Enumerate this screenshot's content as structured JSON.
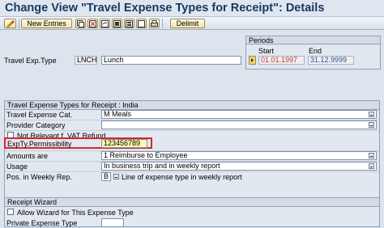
{
  "title": "Change View \"Travel Expense Types for Receipt\": Details",
  "toolbar": {
    "new_entries": "New Entries",
    "delimit": "Delimit"
  },
  "header": {
    "travel_exp_type_label": "Travel Exp.Type",
    "travel_exp_type_code": "LNCH",
    "travel_exp_type_text": "Lunch"
  },
  "periods": {
    "title": "Periods",
    "start_label": "Start",
    "end_label": "End",
    "start_value": "01.01.1997",
    "end_value": "31.12.9999"
  },
  "receipt_group": {
    "title": "Travel Expense Types for Receipt : India",
    "rows": {
      "cat_label": "Travel Expense Cat.",
      "cat_value": "M Meals",
      "provider_label": "Provider Category",
      "provider_value": "",
      "vat_label": "Not Relevant f. VAT Refund",
      "perm_label": "ExpTy.Permissibility",
      "perm_value": "123456789",
      "amounts_label": "Amounts are",
      "amounts_value": "1 Reimburse to Employee",
      "usage_label": "Usage",
      "usage_value": "In business trip and in weekly report",
      "pos_label": "Pos. in Weekly Rep.",
      "pos_code": "B",
      "pos_text": "Line of expense type in weekly report"
    }
  },
  "wizard_group": {
    "title": "Receipt Wizard",
    "allow_label": "Allow Wizard for This Expense Type",
    "private_label": "Private Expense Type",
    "private_value": ""
  },
  "colors": {
    "title": "#17385f",
    "start_date": "#c0392b",
    "end_date": "#1f4f9a",
    "highlight_border": "#d8262b",
    "perm_field_bg": "#fff7b0"
  }
}
